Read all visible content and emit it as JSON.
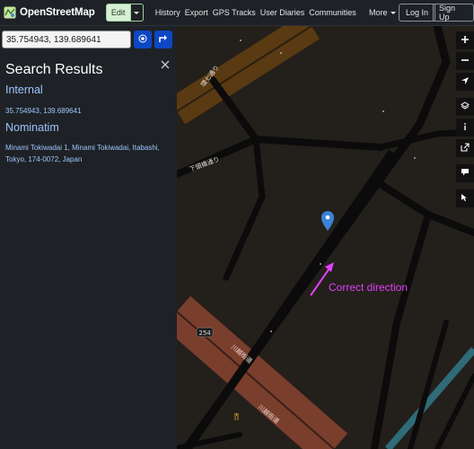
{
  "header": {
    "brand": "OpenStreetMap",
    "edit_label": "Edit",
    "nav": [
      "History",
      "Export",
      "GPS Tracks",
      "User Diaries",
      "Communities"
    ],
    "more_label": "More",
    "login_label": "Log In",
    "signup_label": "Sign Up"
  },
  "search": {
    "value": "35.754943, 139.689641"
  },
  "results": {
    "title": "Search Results",
    "internal": {
      "heading": "Internal",
      "result": "35.754943, 139.689641"
    },
    "nominatim": {
      "heading": "Nominatim",
      "result": "Minami Tokiwadai 1, Minami Tokiwadai, Itabashi, Tokyo, 174-0072, Japan"
    }
  },
  "map": {
    "road_labels": [
      "環七通り",
      "下頭橋通り",
      "川越街道",
      "川越街道",
      "254"
    ],
    "annotation": "Correct direction",
    "icons": [
      "zoom-in-icon",
      "zoom-out-icon",
      "locate-icon",
      "layers-icon",
      "info-icon",
      "share-icon",
      "note-icon",
      "query-icon"
    ]
  },
  "colors": {
    "header_bg": "#1e2226",
    "link": "#9ec5fe",
    "map_bg": "#231f1b",
    "primary_road": "#7a3e2d",
    "secondary_road": "#5a3a12",
    "annotation": "#e040fb",
    "marker": "#3b82d6"
  }
}
